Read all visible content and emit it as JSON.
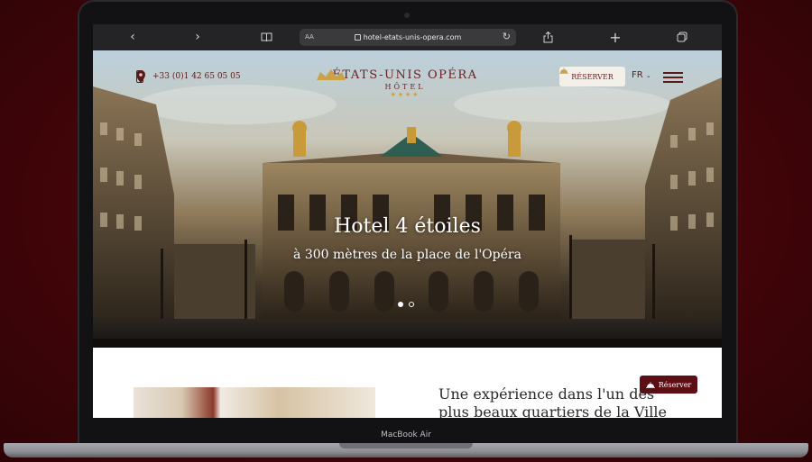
{
  "browser": {
    "url": "hotel-etats-unis-opera.com",
    "reader_label": "AA"
  },
  "header": {
    "phone": "+33 (0)1 42 65 05 05",
    "logo_main": "ÉTATS-UNIS OPÉRA",
    "logo_sub": "HÔTEL",
    "logo_stars": "★★★★",
    "reserve_label": "RÉSERVER",
    "language": "FR"
  },
  "hero": {
    "title": "Hotel 4 étoiles",
    "subtitle": "à 300 mètres de la place de l'Opéra",
    "slide_count": 2,
    "active_slide": 1
  },
  "content": {
    "headline": "Une expérience dans l'un des plus beaux quartiers de la Ville",
    "reserve_float_label": "Réserver"
  },
  "device": {
    "label": "MacBook Air"
  },
  "colors": {
    "brand": "#6b1f1f",
    "button_dark": "#5c0f14",
    "background": "#430509"
  }
}
